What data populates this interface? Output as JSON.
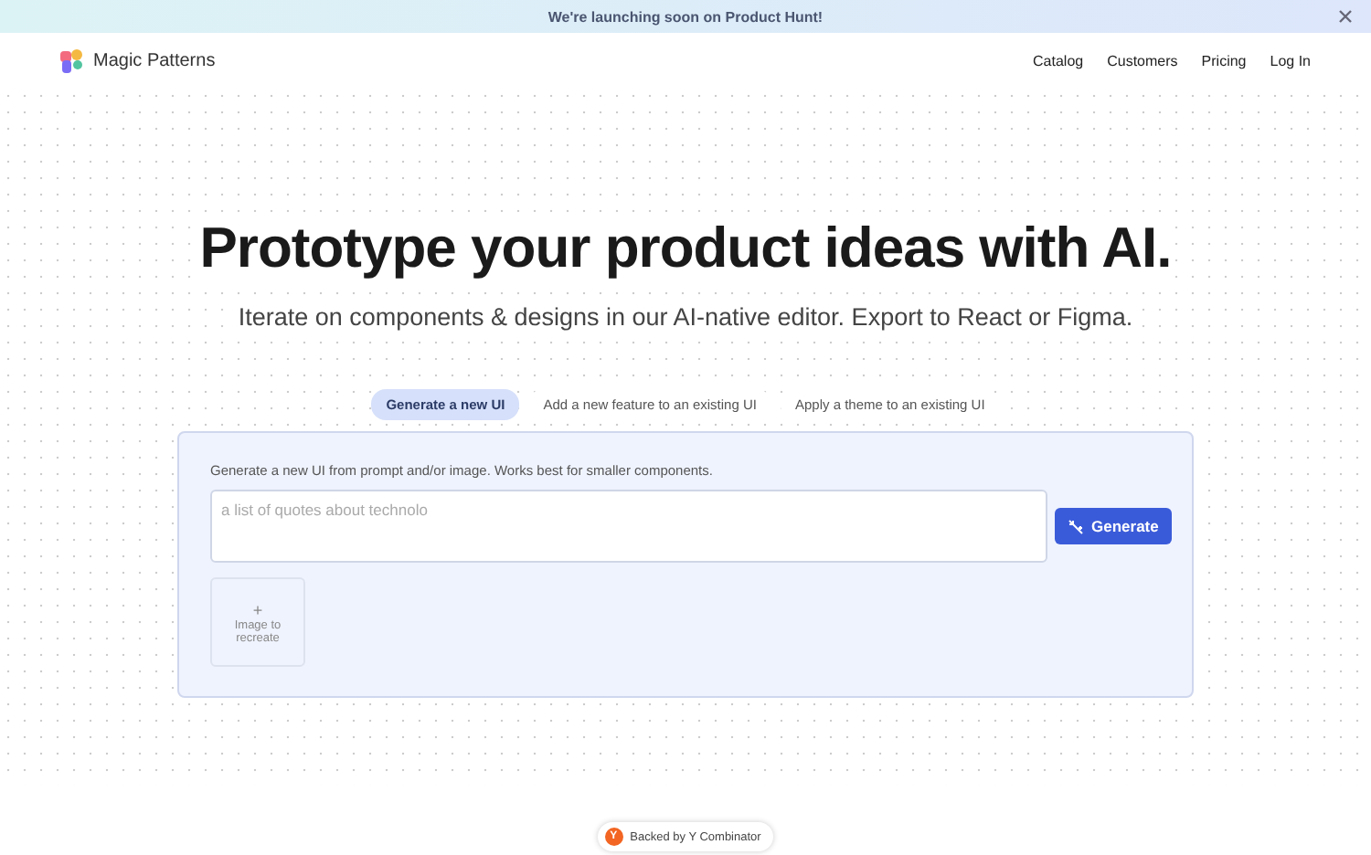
{
  "banner": {
    "text": "We're launching soon on Product Hunt!"
  },
  "nav": {
    "brand": "Magic Patterns",
    "links": [
      "Catalog",
      "Customers",
      "Pricing",
      "Log In"
    ]
  },
  "hero": {
    "title": "Prototype your product ideas with AI.",
    "subtitle": "Iterate on components & designs in our AI-native editor. Export to React or Figma."
  },
  "tabs": [
    {
      "label": "Generate a new UI",
      "selected": true
    },
    {
      "label": "Add a new feature to an existing UI",
      "selected": false
    },
    {
      "label": "Apply a theme to an existing UI",
      "selected": false
    }
  ],
  "prompt_card": {
    "hint": "Generate a new UI from prompt and/or image. Works best for smaller components.",
    "placeholder": "a list of quotes about technolo",
    "button": "Generate",
    "upload_plus": "+",
    "upload_label": "Image to recreate"
  },
  "badge": {
    "logo": "Y",
    "text": "Backed by Y Combinator"
  }
}
